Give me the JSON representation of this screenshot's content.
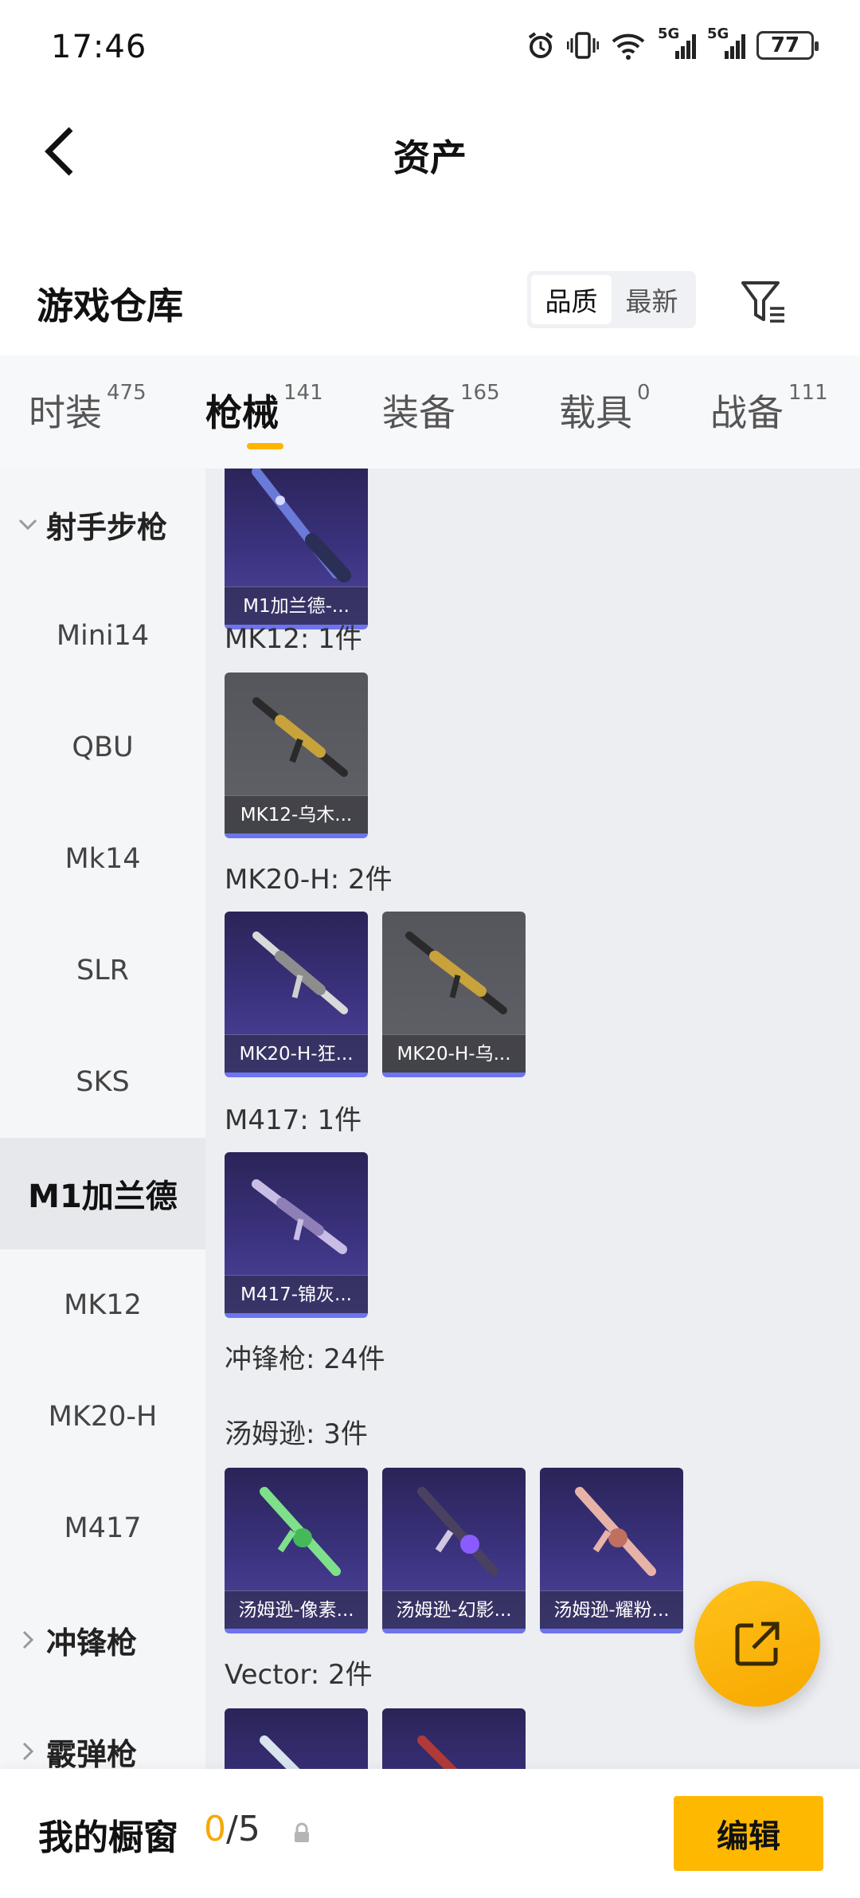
{
  "status_bar": {
    "time": "17:46",
    "battery": "77",
    "net1": "5G",
    "net2": "5G"
  },
  "nav": {
    "title": "资产"
  },
  "section": {
    "title": "游戏仓库",
    "sort_quality": "品质",
    "sort_latest": "最新"
  },
  "tabs": [
    {
      "label": "时装",
      "count": "475"
    },
    {
      "label": "枪械",
      "count": "141"
    },
    {
      "label": "装备",
      "count": "165"
    },
    {
      "label": "载具",
      "count": "0"
    },
    {
      "label": "战备",
      "count": "111"
    }
  ],
  "active_tab": "枪械",
  "sidebar": {
    "items": [
      {
        "label": "射手步枪",
        "type": "group-expanded"
      },
      {
        "label": "Mini14"
      },
      {
        "label": "QBU"
      },
      {
        "label": "Mk14"
      },
      {
        "label": "SLR"
      },
      {
        "label": "SKS"
      },
      {
        "label": "M1加兰德",
        "active": true
      },
      {
        "label": "MK12"
      },
      {
        "label": "MK20-H"
      },
      {
        "label": "M417"
      },
      {
        "label": "冲锋枪",
        "type": "group-collapsed"
      },
      {
        "label": "霰弹枪",
        "type": "group-collapsed"
      }
    ]
  },
  "content": {
    "groups": [
      {
        "label": "",
        "cards": [
          {
            "label": "M1加兰德-...",
            "style": "purple"
          }
        ]
      },
      {
        "label": "MK12: 1件",
        "cards": [
          {
            "label": "MK12-乌木...",
            "style": "grey"
          }
        ]
      },
      {
        "label": "MK20-H: 2件",
        "cards": [
          {
            "label": "MK20-H-狂...",
            "style": "purple"
          },
          {
            "label": "MK20-H-乌...",
            "style": "grey"
          }
        ]
      },
      {
        "label": "M417: 1件",
        "cards": [
          {
            "label": "M417-锦灰...",
            "style": "purple"
          }
        ]
      },
      {
        "label": "冲锋枪: 24件",
        "cards": []
      },
      {
        "label": "汤姆逊: 3件",
        "cards": [
          {
            "label": "汤姆逊-像素...",
            "style": "purple"
          },
          {
            "label": "汤姆逊-幻影...",
            "style": "purple"
          },
          {
            "label": "汤姆逊-耀粉...",
            "style": "purple"
          }
        ]
      },
      {
        "label": "Vector: 2件",
        "cards": [
          {
            "label": "",
            "style": "purple"
          },
          {
            "label": "",
            "style": "purple"
          }
        ]
      }
    ]
  },
  "bottom_bar": {
    "showcase_label": "我的橱窗",
    "used": "0",
    "total": "/5",
    "edit_label": "编辑"
  },
  "colors": {
    "accent": "#ffb800",
    "purple_card": "#3c3380",
    "grey_card": "#5a5b61"
  }
}
